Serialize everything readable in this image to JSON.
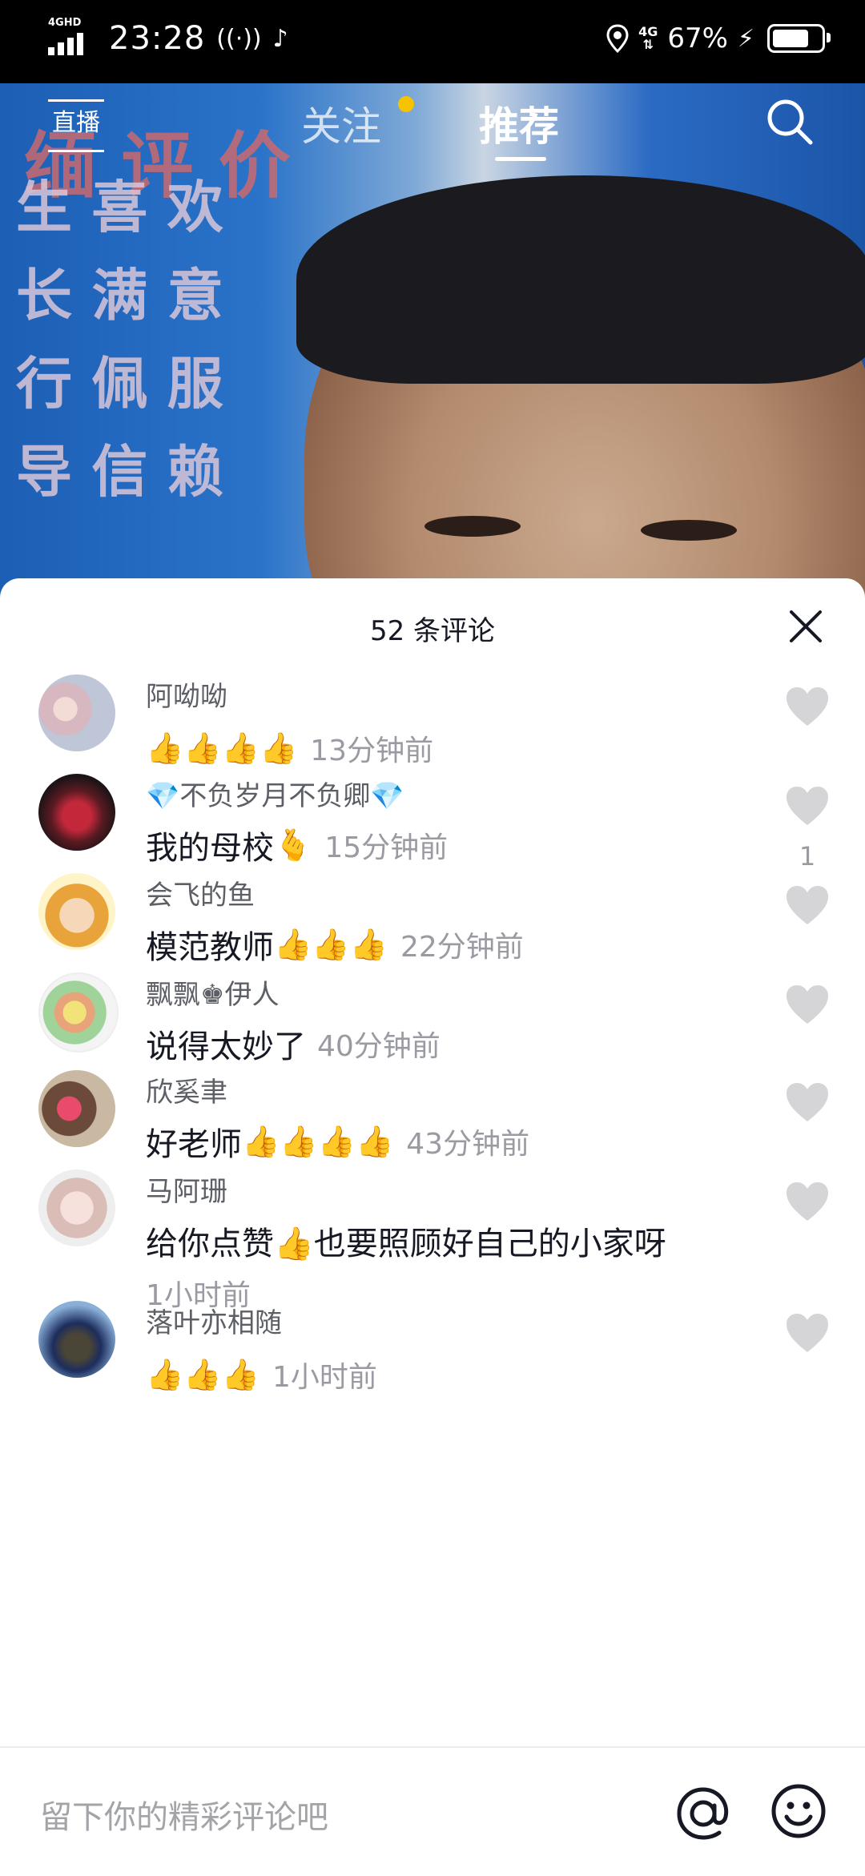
{
  "status_bar": {
    "network_label": "4GHD",
    "time": "23:28",
    "mobile_data": "4G",
    "battery": "67%"
  },
  "video": {
    "banner_lines": [
      "生 喜 欢",
      "长 满 意",
      "行 佩 服",
      "导 信 赖"
    ],
    "banner_title": "缅 评 价"
  },
  "top_nav": {
    "live_label": "直播",
    "tabs": [
      {
        "label": "关注",
        "has_dot": true
      },
      {
        "label": "推荐",
        "active": true
      }
    ]
  },
  "comments_sheet": {
    "title": "52 条评论",
    "comments": [
      {
        "name": "阿呦呦",
        "text": "",
        "emoji": "👍👍👍👍",
        "time": "13分钟前",
        "likes": ""
      },
      {
        "name": "💎不负岁月不负卿💎",
        "text": "我的母校",
        "emoji": "🫰",
        "time": "15分钟前",
        "likes": "1"
      },
      {
        "name": "会飞的鱼",
        "text": "模范教师",
        "emoji": "👍👍👍",
        "time": "22分钟前",
        "likes": ""
      },
      {
        "name": "飘飘♚伊人",
        "text": "说得太妙了",
        "emoji": "",
        "time": "40分钟前",
        "likes": ""
      },
      {
        "name": "欣奚聿",
        "text": "好老师",
        "emoji": "👍👍👍👍",
        "time": "43分钟前",
        "likes": ""
      },
      {
        "name": "马阿珊",
        "text": "给你点赞👍也要照顾好自己的小家呀",
        "emoji": "",
        "time": "1小时前",
        "likes": ""
      },
      {
        "name": "落叶亦相随",
        "text": "",
        "emoji": "👍👍👍",
        "time": "1小时前",
        "likes": ""
      }
    ]
  },
  "input_bar": {
    "placeholder": "留下你的精彩评论吧"
  }
}
